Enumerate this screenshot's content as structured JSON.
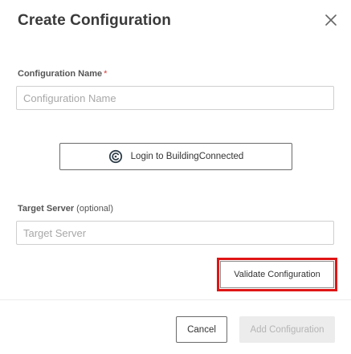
{
  "dialog": {
    "title": "Create Configuration",
    "close_icon": "close-icon"
  },
  "config_name": {
    "label": "Configuration Name",
    "required_marker": "*",
    "placeholder": "Configuration Name",
    "value": ""
  },
  "login": {
    "label": "Login to BuildingConnected",
    "icon": "buildingconnected-logo-icon",
    "icon_color": "#2f3e4a"
  },
  "target_server": {
    "label": "Target Server",
    "optional_text": "(optional)",
    "placeholder": "Target Server",
    "value": ""
  },
  "validate": {
    "label": "Validate Configuration",
    "highlight_color": "#e01515"
  },
  "footer": {
    "cancel_label": "Cancel",
    "add_label": "Add Configuration",
    "add_disabled": true
  }
}
